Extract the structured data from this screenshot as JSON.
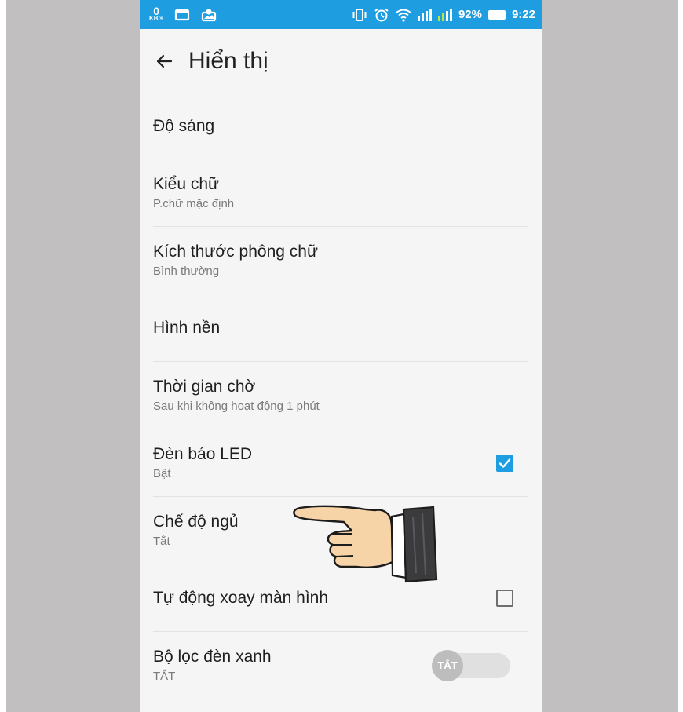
{
  "status_bar": {
    "network_speed_value": "0",
    "network_speed_unit": "KB/s",
    "battery": "92%",
    "time": "9:22"
  },
  "appbar": {
    "title": "Hiển thị"
  },
  "settings": [
    {
      "title": "Độ sáng",
      "subtitle": ""
    },
    {
      "title": "Kiểu chữ",
      "subtitle": "P.chữ mặc định"
    },
    {
      "title": "Kích thước phông chữ",
      "subtitle": "Bình thường"
    },
    {
      "title": "Hình nền",
      "subtitle": ""
    },
    {
      "title": "Thời gian chờ",
      "subtitle": "Sau khi không hoạt động 1 phút"
    },
    {
      "title": "Đèn báo LED",
      "subtitle": "Bật",
      "checked": true
    },
    {
      "title": "Chế độ ngủ",
      "subtitle": "Tắt"
    },
    {
      "title": "Tự động xoay màn hình",
      "subtitle": "",
      "checked": false
    },
    {
      "title": "Bộ lọc đèn xanh",
      "subtitle": "TẮT",
      "switch_label": "TẮT",
      "switch_on": false
    }
  ],
  "colors": {
    "accent": "#1e9ee0",
    "background": "#f5f5f5",
    "side_panel": "#c1bfc0"
  },
  "icons": [
    "back-arrow-icon",
    "message-icon",
    "gallery-notification-icon",
    "vibrate-icon",
    "alarm-icon",
    "wifi-icon",
    "signal-icon",
    "battery-icon",
    "pointing-hand-icon",
    "check-icon"
  ]
}
